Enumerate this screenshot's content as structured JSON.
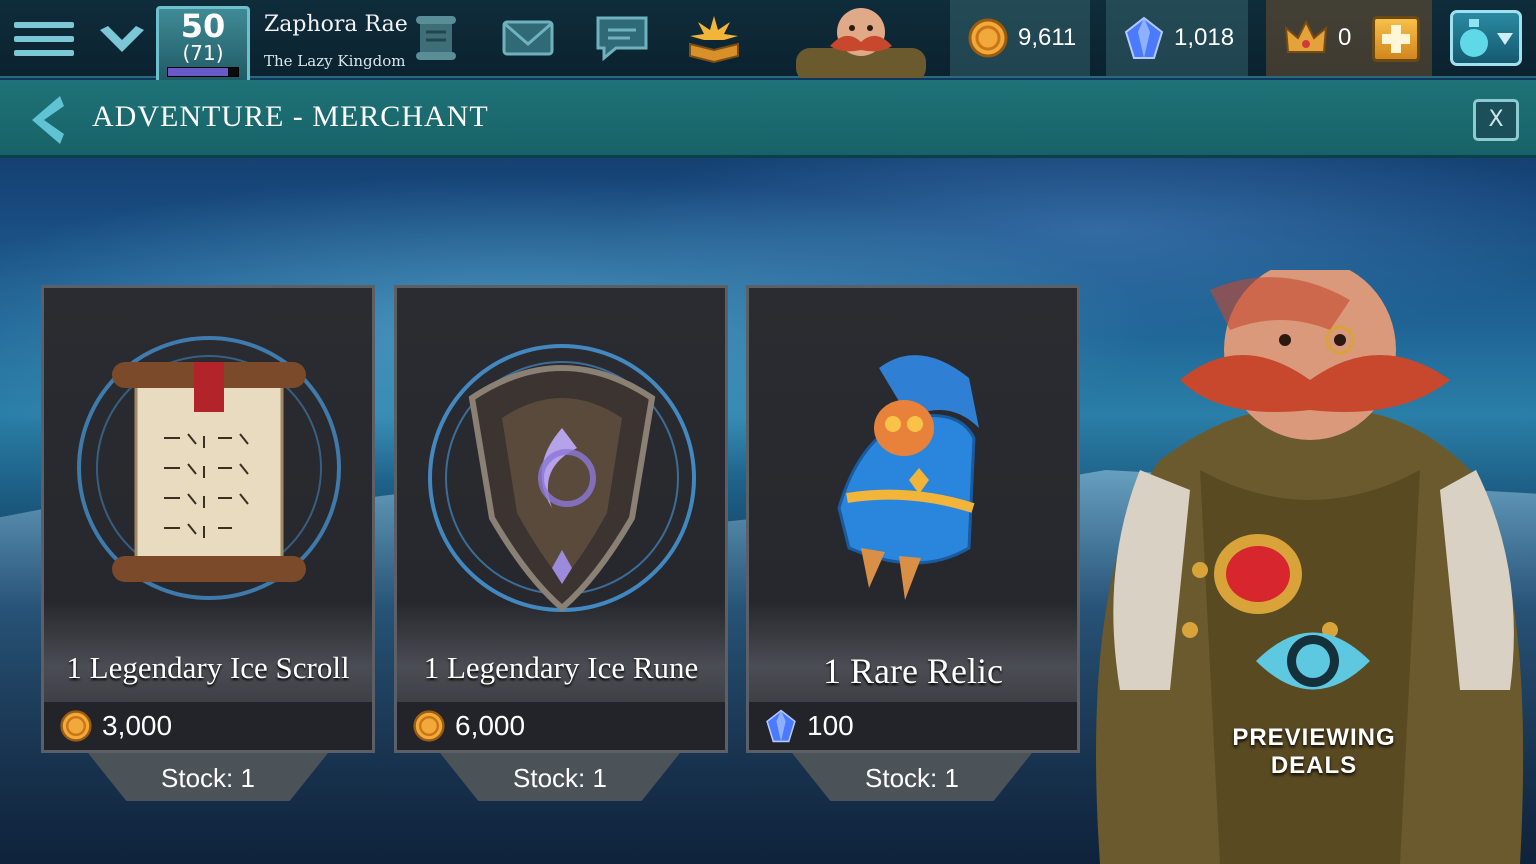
{
  "player": {
    "level": "50",
    "level_sub": "(71)",
    "xp_progress": 0.85,
    "name": "Zaphora Rae",
    "kingdom": "The Lazy Kingdom"
  },
  "resources": {
    "gold": "9,611",
    "gems": "1,018",
    "crowns": "0"
  },
  "header": {
    "title": "ADVENTURE - MERCHANT",
    "close_label": "X"
  },
  "offers": [
    {
      "name": "1 Legendary Ice Scroll",
      "price": "3,000",
      "currency": "gold-coin",
      "stock": "Stock: 1"
    },
    {
      "name": "1 Legendary Ice Rune",
      "price": "6,000",
      "currency": "gold-coin",
      "stock": "Stock: 1"
    },
    {
      "name": "1 Rare Relic",
      "price": "100",
      "currency": "gem",
      "stock": "Stock: 1"
    }
  ],
  "preview": {
    "label": "PREVIEWING DEALS"
  },
  "icons": [
    "menu-icon",
    "chevron-down-icon",
    "scroll-quest-icon",
    "mail-icon",
    "chat-icon",
    "guild-book-icon",
    "gold-coin-icon",
    "gem-icon",
    "crown-icon",
    "plus-icon",
    "potion-icon",
    "back-arrow-icon",
    "eye-icon"
  ],
  "colors": {
    "topbar": "#0f2c3a",
    "titlebar": "#1e7377",
    "accent": "#6cc1cc",
    "gold": "#f2a93b",
    "gem": "#4a7bff",
    "card": "#2a2c31"
  }
}
